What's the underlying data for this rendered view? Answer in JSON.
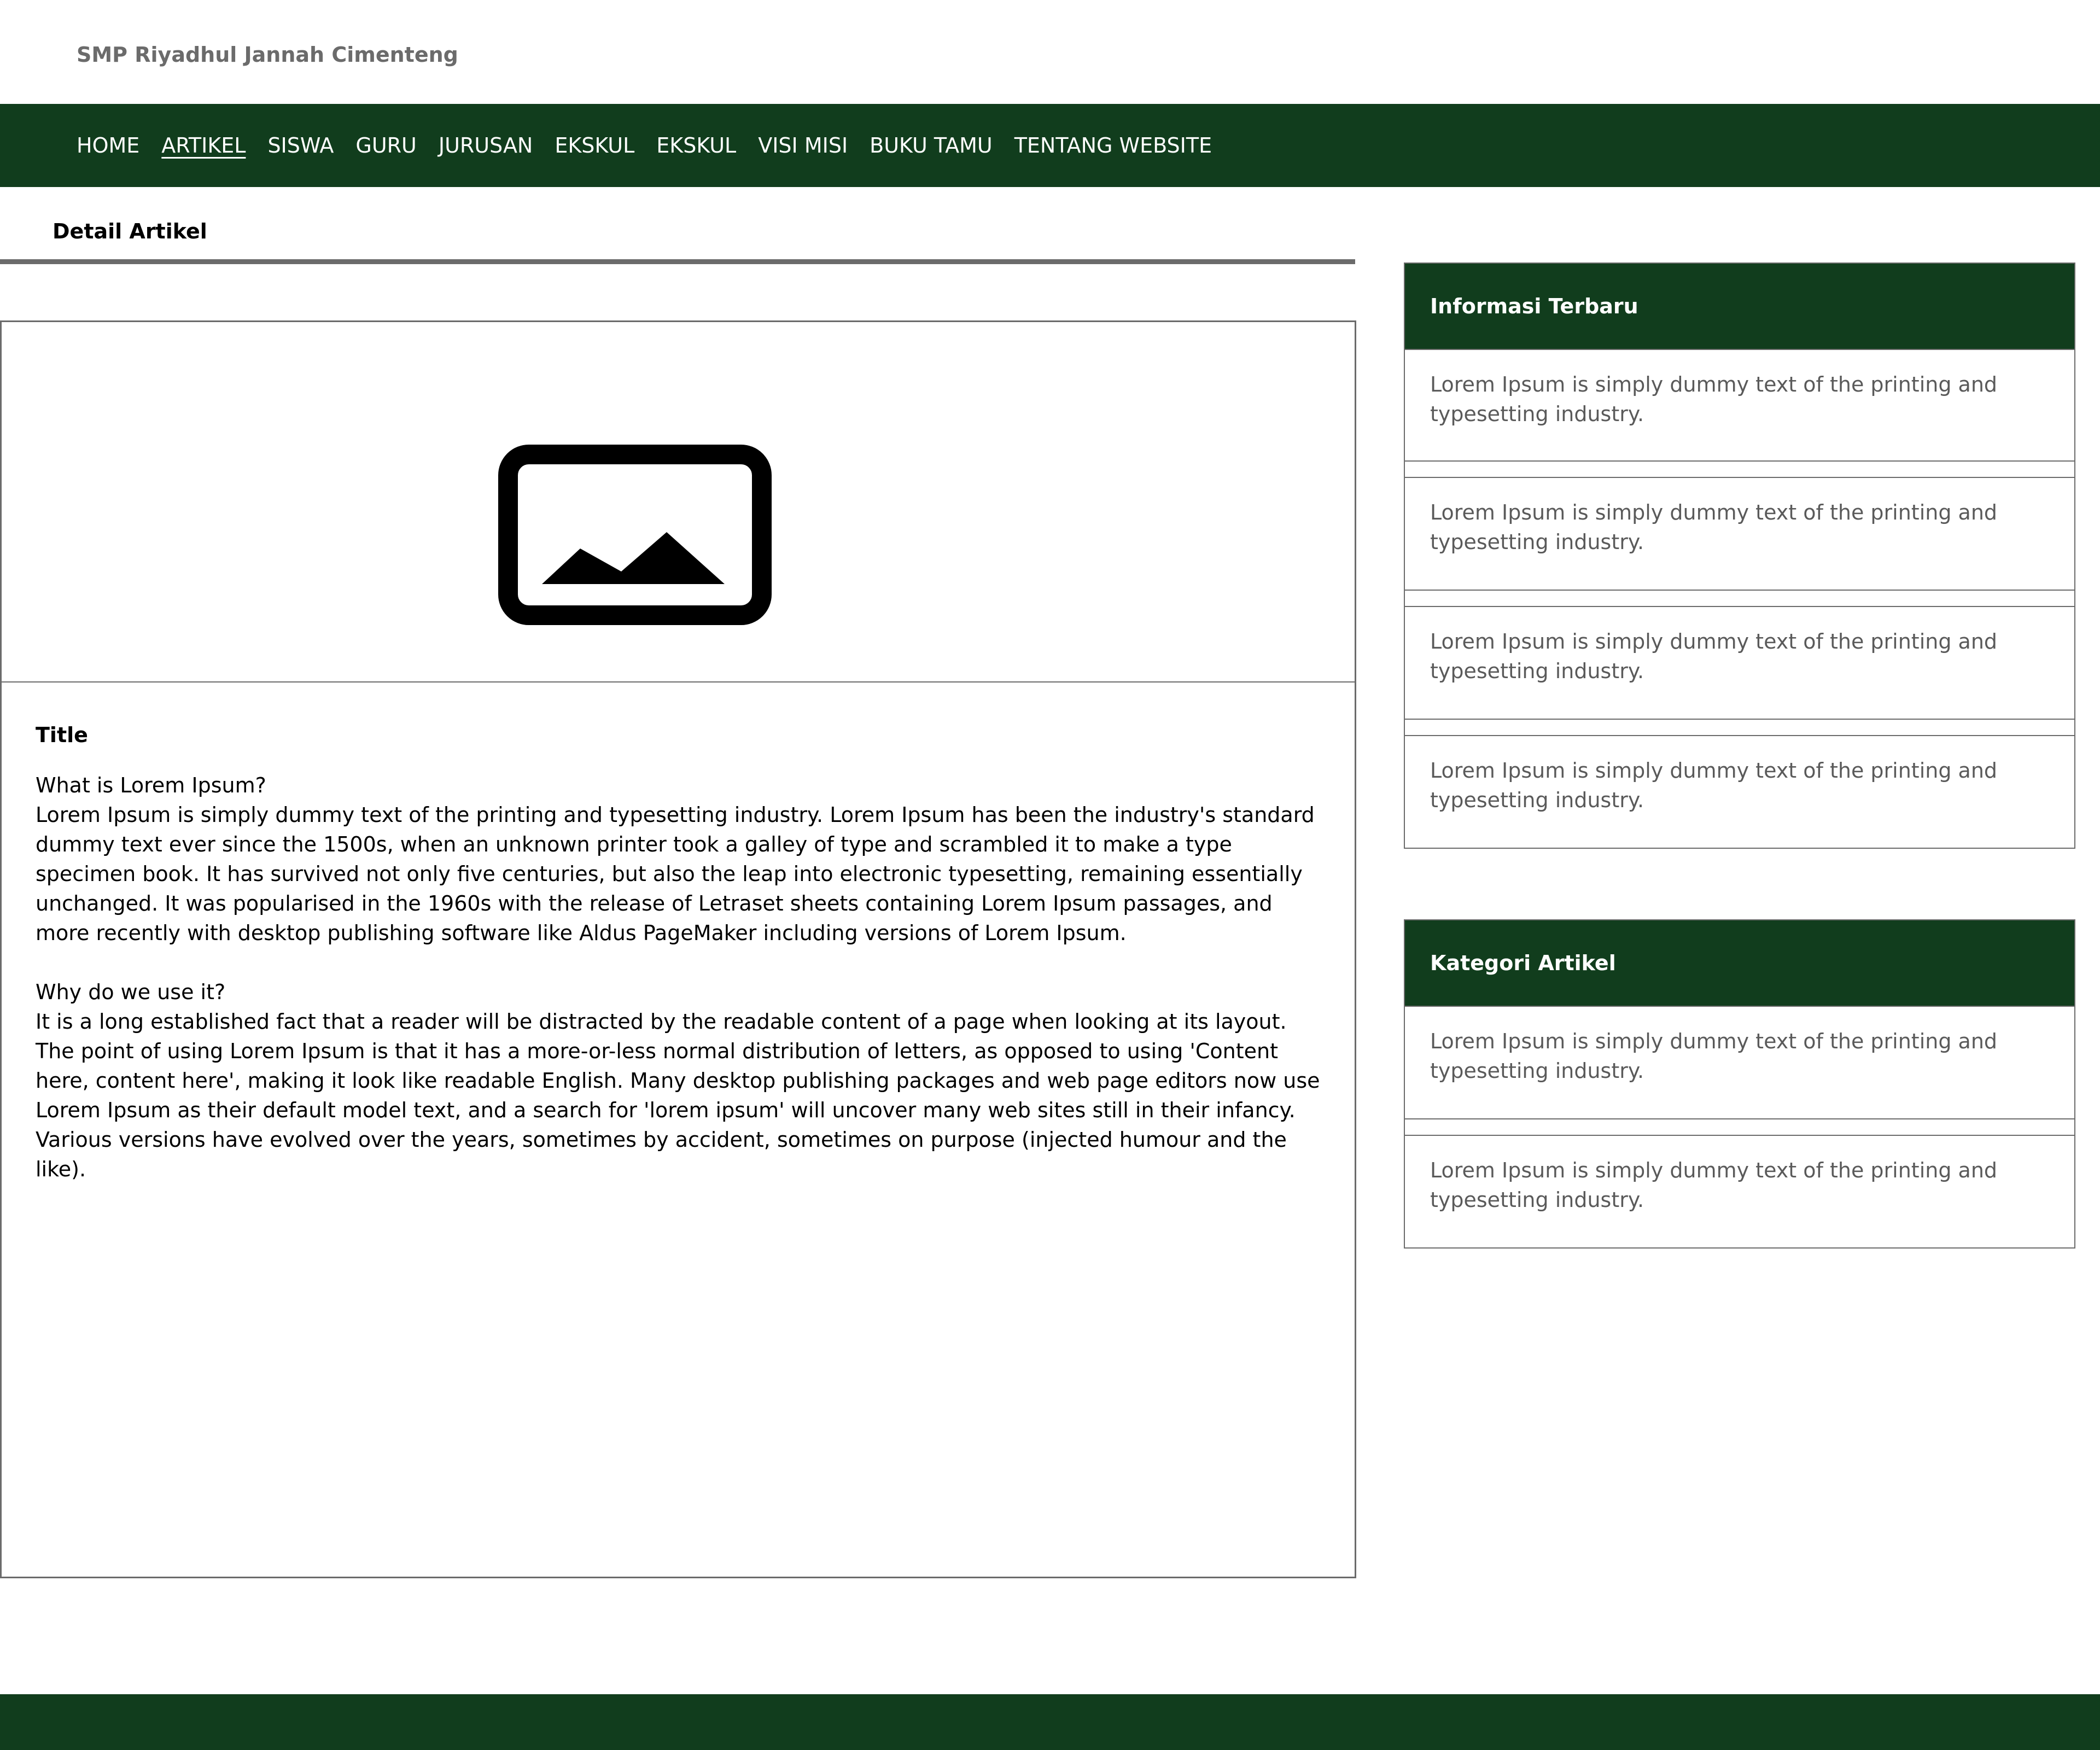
{
  "header": {
    "site_title": "SMP Riyadhul Jannah Cimenteng"
  },
  "nav": {
    "items": [
      {
        "label": "HOME"
      },
      {
        "label": "ARTIKEL"
      },
      {
        "label": "SISWA"
      },
      {
        "label": "GURU"
      },
      {
        "label": "JURUSAN"
      },
      {
        "label": "EKSKUL"
      },
      {
        "label": "EKSKUL"
      },
      {
        "label": "VISI MISI"
      },
      {
        "label": "BUKU TAMU"
      },
      {
        "label": "TENTANG WEBSITE"
      }
    ],
    "active_label": "ARTIKEL"
  },
  "main": {
    "section_heading": "Detail Artikel",
    "article": {
      "image_icon": "image-placeholder-icon",
      "title": "Title",
      "q1": "What is Lorem Ipsum?",
      "p1": "Lorem Ipsum is simply dummy text of the printing and typesetting industry. Lorem Ipsum has been the industry's standard dummy text ever since the 1500s, when an unknown printer took a galley of type and scrambled it to make a type specimen book. It has survived not only five centuries, but also the leap into electronic typesetting, remaining essentially unchanged. It was popularised in the 1960s with the release of Letraset sheets containing Lorem Ipsum passages, and more recently with desktop publishing software like Aldus PageMaker including versions of Lorem Ipsum.",
      "q2": "Why do we use it?",
      "p2": "It is a long established fact that a reader will be distracted by the readable content of a page when looking at its layout. The point of using Lorem Ipsum is that it has a more-or-less normal distribution of letters, as opposed to using 'Content here, content here', making it look like readable English. Many desktop publishing packages and web page editors now use Lorem Ipsum as their default model text, and a search for 'lorem ipsum' will uncover many web sites still in their infancy. Various versions have evolved over the years, sometimes by accident, sometimes on purpose (injected humour and the like)."
    }
  },
  "sidebar": {
    "latest": {
      "title": "Informasi Terbaru",
      "items": [
        "Lorem Ipsum is simply dummy text of the printing and typesetting industry.",
        "Lorem Ipsum is simply dummy text of the printing and typesetting industry.",
        "Lorem Ipsum is simply dummy text of the printing and typesetting industry.",
        "Lorem Ipsum is simply dummy text of the printing and typesetting industry."
      ]
    },
    "categories": {
      "title": "Kategori Artikel",
      "items": [
        "Lorem Ipsum is simply dummy text of the printing and typesetting industry.",
        "Lorem Ipsum is simply dummy text of the printing and typesetting industry."
      ]
    }
  },
  "colors": {
    "brand_green": "#113d1d",
    "border_gray": "#6b6b6b",
    "muted_text": "#5a5a5a"
  }
}
